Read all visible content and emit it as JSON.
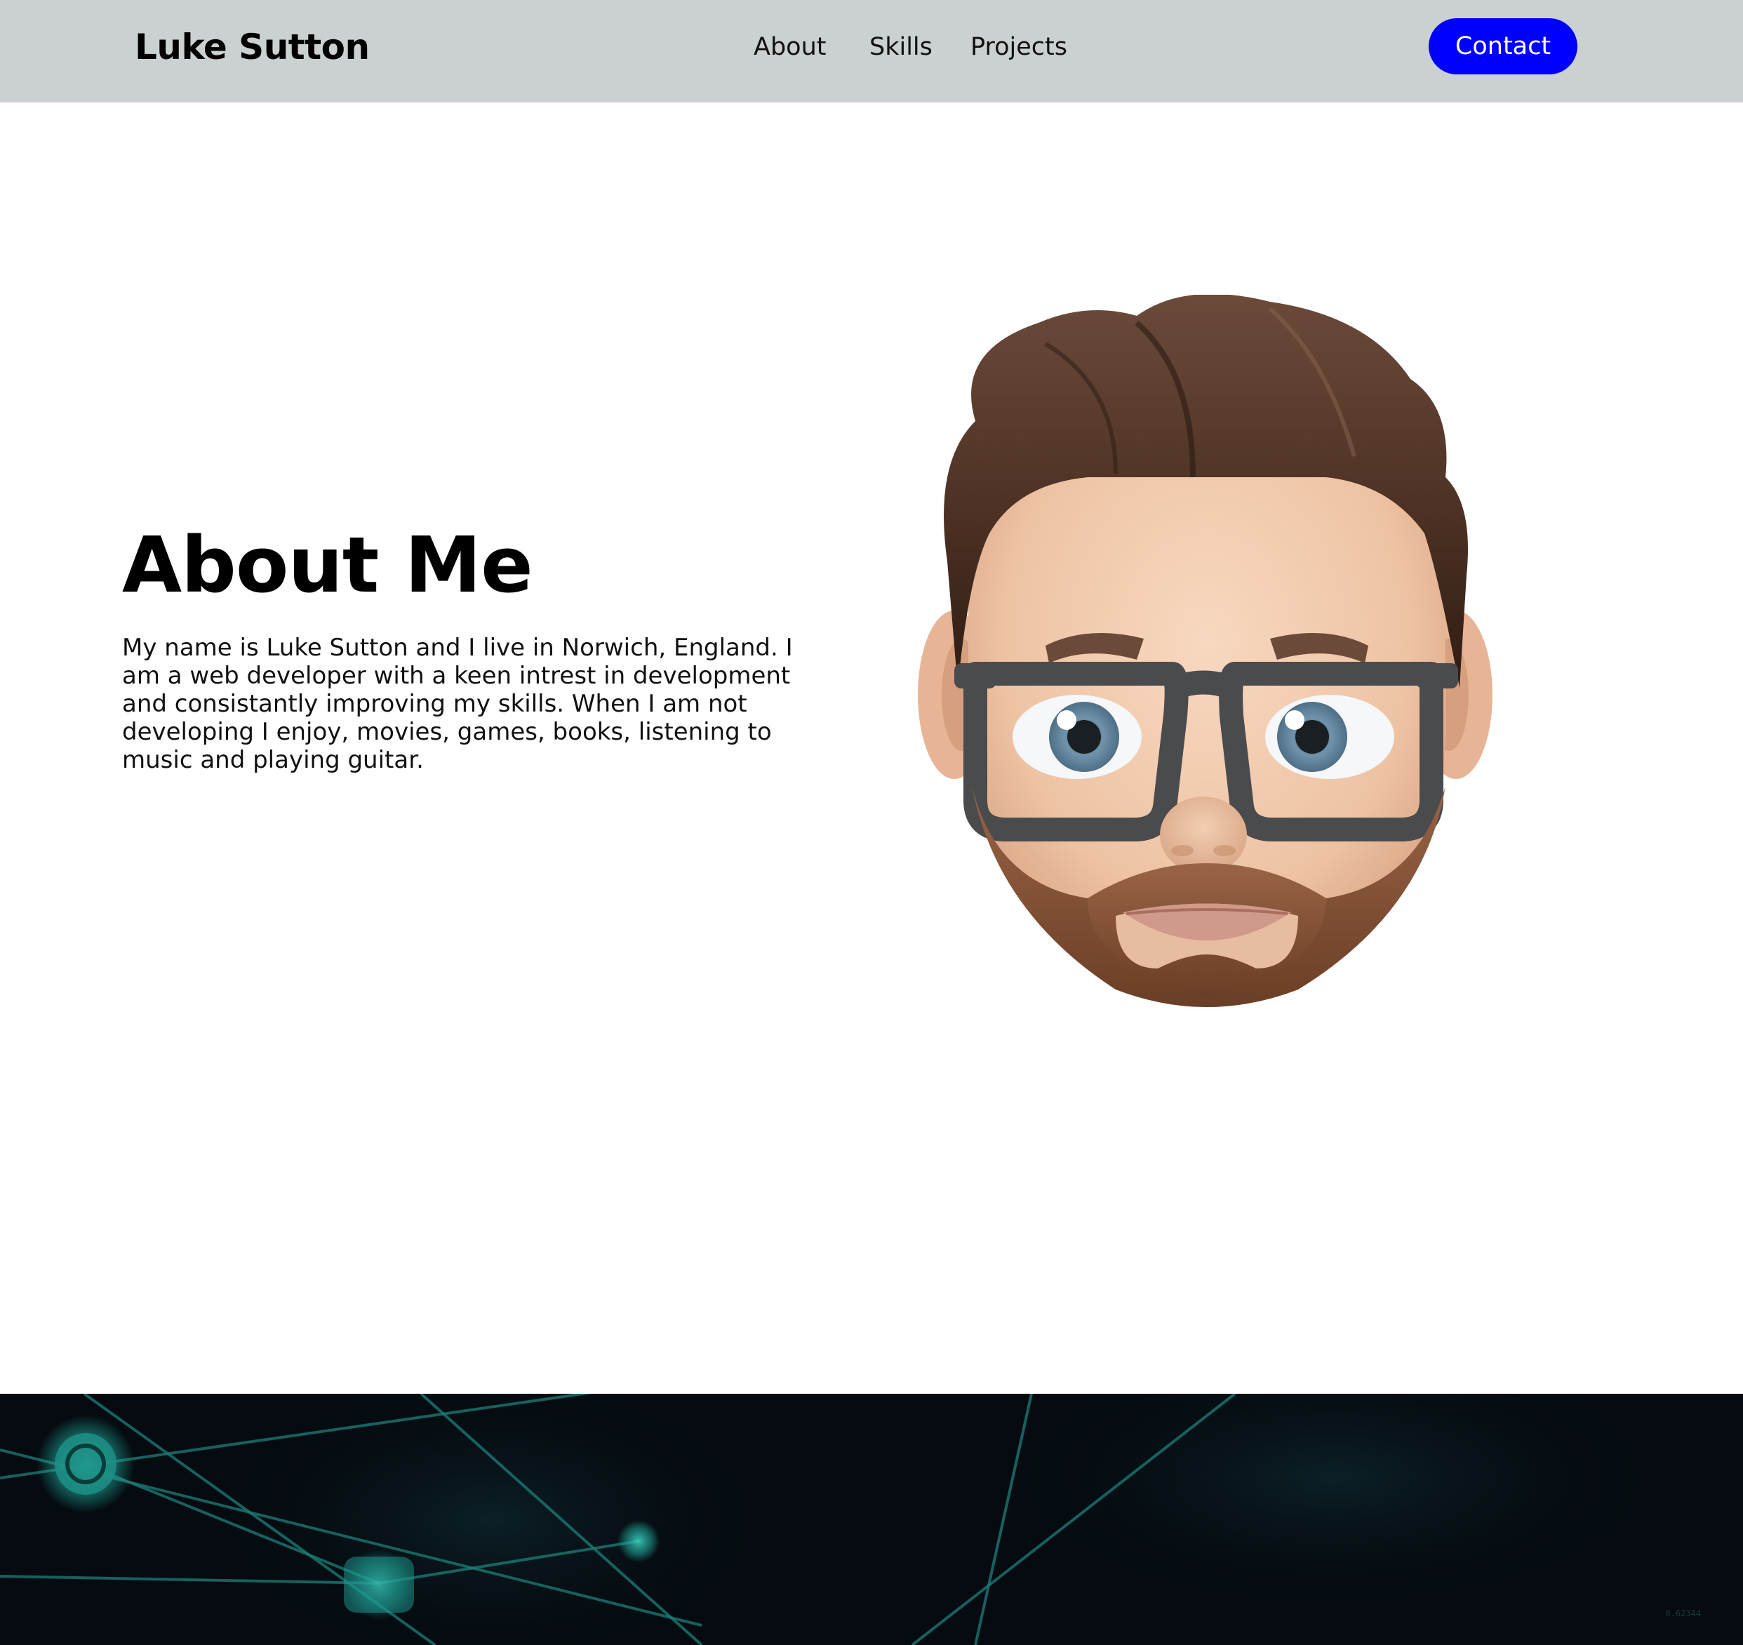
{
  "header": {
    "brand": "Luke Sutton",
    "nav": [
      {
        "label": "About"
      },
      {
        "label": "Skills"
      },
      {
        "label": "Projects"
      }
    ],
    "contact_label": "Contact",
    "background_color": "#cbd0d0",
    "contact_color": "#0000ff"
  },
  "about": {
    "title": "About Me",
    "text": "My name is Luke Sutton and I live in Norwich, England. I am a web developer with a keen intrest in development and consistantly improving my skills. When I am not developing I enjoy, movies, games, books, listening to music and playing guitar.",
    "avatar_icon": "memoji-avatar"
  },
  "band": {
    "background_color": "#050b10",
    "accent_color": "#1fa69a",
    "tag": "0.62344"
  }
}
